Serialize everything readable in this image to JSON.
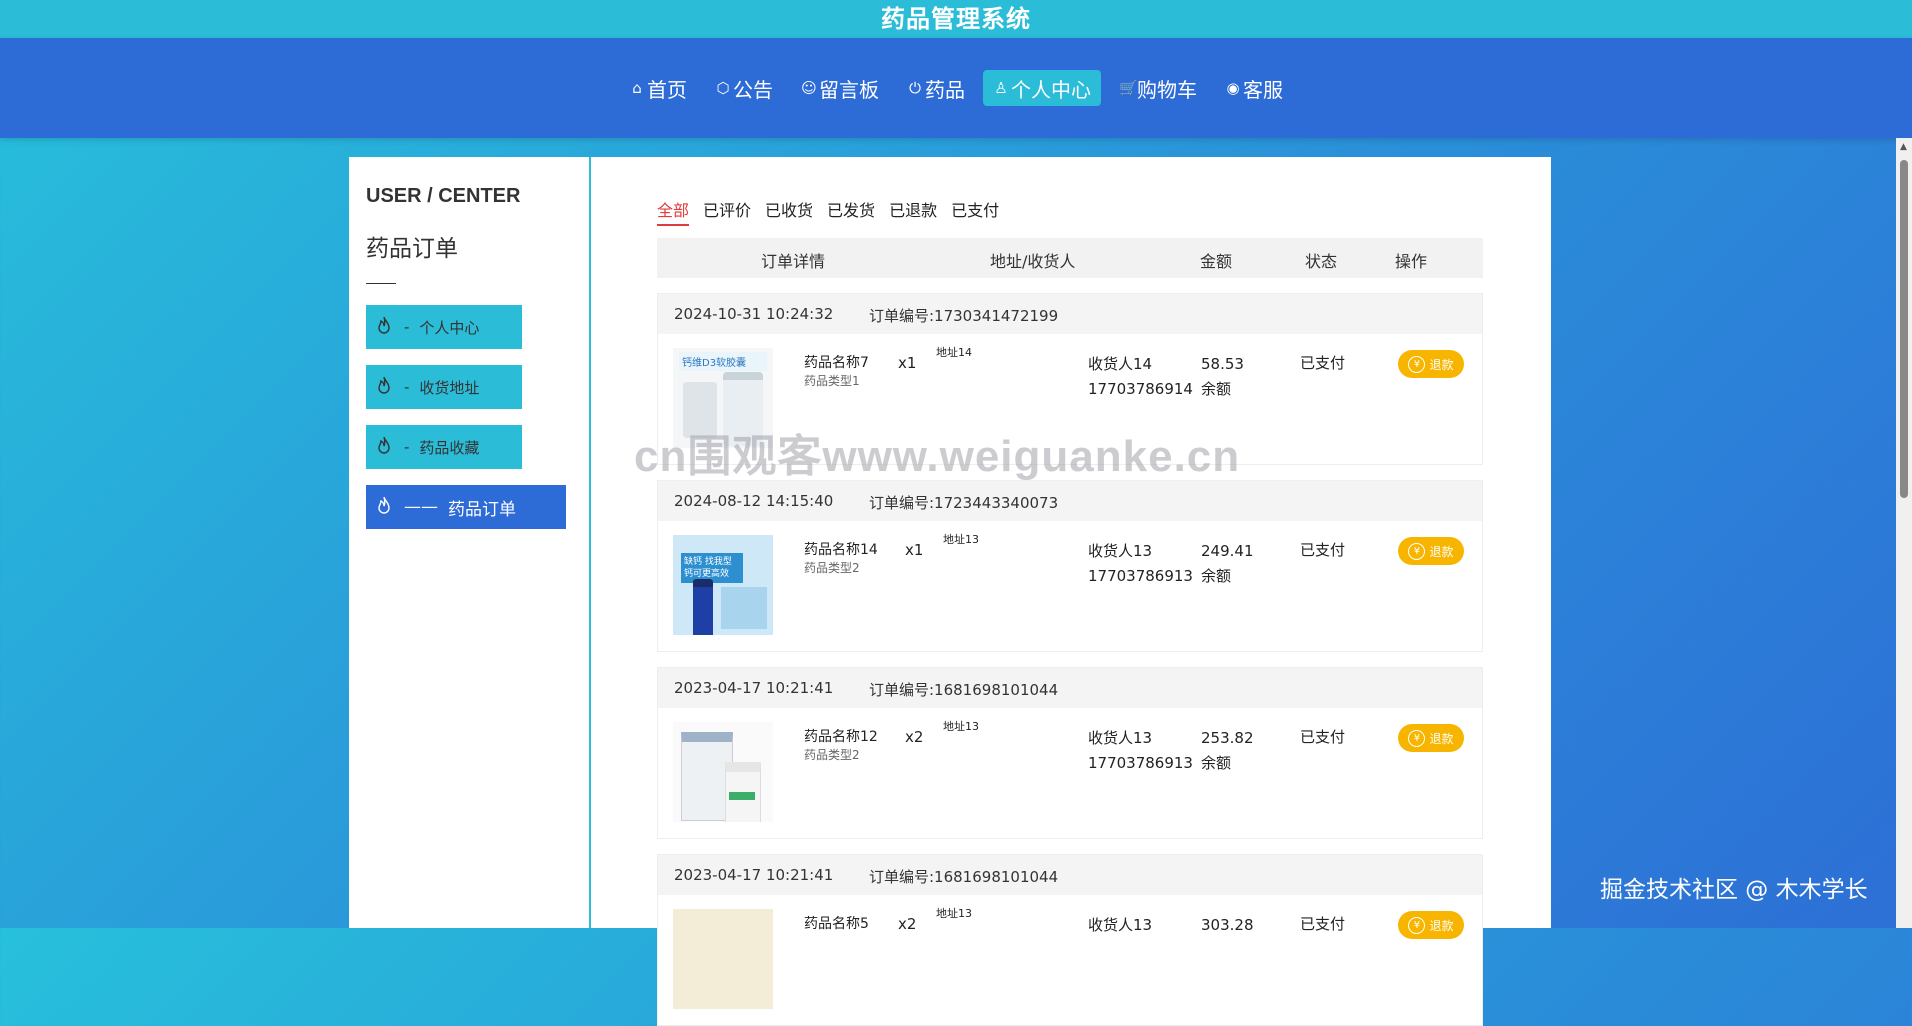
{
  "app": {
    "title": "药品管理系统"
  },
  "nav": {
    "items": [
      {
        "label": "首页",
        "icon": "home-icon",
        "glyph": "⌂",
        "active": false
      },
      {
        "label": "公告",
        "icon": "box-icon",
        "glyph": "⬡",
        "active": false
      },
      {
        "label": "留言板",
        "icon": "smile-icon",
        "glyph": "☺",
        "active": false
      },
      {
        "label": "药品",
        "icon": "power-icon",
        "glyph": "⏻",
        "active": false
      },
      {
        "label": "个人中心",
        "icon": "user-icon",
        "glyph": "♙",
        "active": true
      },
      {
        "label": "购物车",
        "icon": "cart-icon",
        "glyph": "🛒",
        "active": false
      },
      {
        "label": "客服",
        "icon": "chat-icon",
        "glyph": "◉",
        "active": false
      }
    ]
  },
  "sidebar": {
    "heading": "USER / CENTER",
    "subheading": "药品订单",
    "items": [
      {
        "label": "个人中心",
        "active": false,
        "dash": "-"
      },
      {
        "label": "收货地址",
        "active": false,
        "dash": "-"
      },
      {
        "label": "药品收藏",
        "active": false,
        "dash": "-"
      },
      {
        "label": "药品订单",
        "active": true,
        "dash": "——"
      }
    ]
  },
  "orders_panel": {
    "tabs": [
      "全部",
      "已评价",
      "已收货",
      "已发货",
      "已退款",
      "已支付"
    ],
    "active_tab": "全部",
    "columns": [
      "订单详情",
      "地址/收货人",
      "金额",
      "状态",
      "操作"
    ],
    "refund_label": "退款",
    "orders": [
      {
        "time": "2024-10-31 10:24:32",
        "order_no": "订单编号:1730341472199",
        "name": "药品名称7",
        "type": "药品类型1",
        "qty": "x1",
        "address": "地址14",
        "receiver": "收货人14",
        "phone": "17703786914",
        "amount": "58.53",
        "pay": "余额",
        "status": "已支付",
        "thumb_label": "钙维D3软胶囊"
      },
      {
        "time": "2024-08-12 14:15:40",
        "order_no": "订单编号:1723443340073",
        "name": "药品名称14",
        "type": "药品类型2",
        "qty": "x1",
        "address": "地址13",
        "receiver": "收货人13",
        "phone": "17703786913",
        "amount": "249.41",
        "pay": "余额",
        "status": "已支付",
        "thumb_label": "缺钙 找我型 钙可更高效"
      },
      {
        "time": "2023-04-17 10:21:41",
        "order_no": "订单编号:1681698101044",
        "name": "药品名称12",
        "type": "药品类型2",
        "qty": "x2",
        "address": "地址13",
        "receiver": "收货人13",
        "phone": "17703786913",
        "amount": "253.82",
        "pay": "余额",
        "status": "已支付",
        "thumb_label": ""
      },
      {
        "time": "2023-04-17 10:21:41",
        "order_no": "订单编号:1681698101044",
        "name": "药品名称5",
        "type": "",
        "qty": "x2",
        "address": "地址13",
        "receiver": "收货人13",
        "phone": "",
        "amount": "303.28",
        "pay": "",
        "status": "已支付",
        "thumb_label": ""
      }
    ]
  },
  "watermark": "cn围观客www.weiguanke.cn",
  "credit": "掘金技术社区 @ 木木学长",
  "colors": {
    "cyan": "#2bbcd8",
    "blue": "#2d6bd6",
    "refund": "#f7b500",
    "active_tab": "#e23b3b"
  }
}
